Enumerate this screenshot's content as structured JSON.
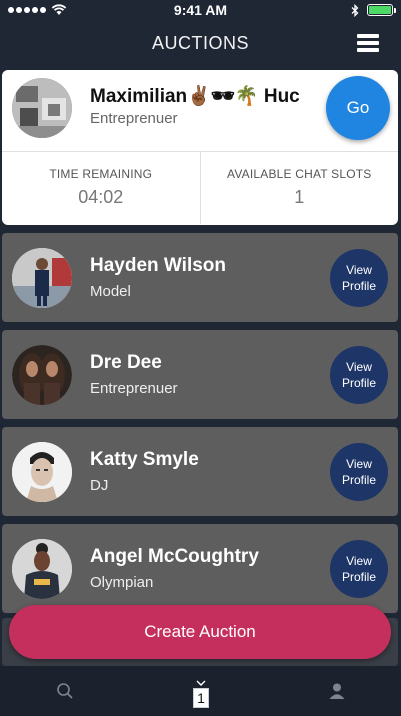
{
  "status_bar": {
    "time": "9:41 AM",
    "battery_level": 1.0
  },
  "header": {
    "title": "AUCTIONS"
  },
  "featured": {
    "name": "Maximilian✌🏾🕶🌴 Huc",
    "role": "Entreprenuer",
    "go_label": "Go",
    "time_remaining_label": "TIME REMAINING",
    "time_remaining_value": "04:02",
    "chat_slots_label": "AVAILABLE CHAT SLOTS",
    "chat_slots_value": "1"
  },
  "users": [
    {
      "name": "Hayden Wilson",
      "role": "Model",
      "button": "View Profile"
    },
    {
      "name": "Dre Dee",
      "role": "Entreprenuer",
      "button": "View Profile"
    },
    {
      "name": "Katty Smyle",
      "role": "DJ",
      "button": "View Profile"
    },
    {
      "name": "Angel McCoughtry",
      "role": "Olympian",
      "button": "View Profile"
    }
  ],
  "create_button": "Create Auction",
  "tabbar": {
    "auction_badge": "1",
    "icons": [
      "search-icon",
      "auction-icon",
      "profile-icon"
    ]
  },
  "colors": {
    "background": "#1f2735",
    "card": "#5e5e5e",
    "go_button": "#1f85e0",
    "view_button": "#1e3667",
    "create_button": "#c52f5e"
  }
}
